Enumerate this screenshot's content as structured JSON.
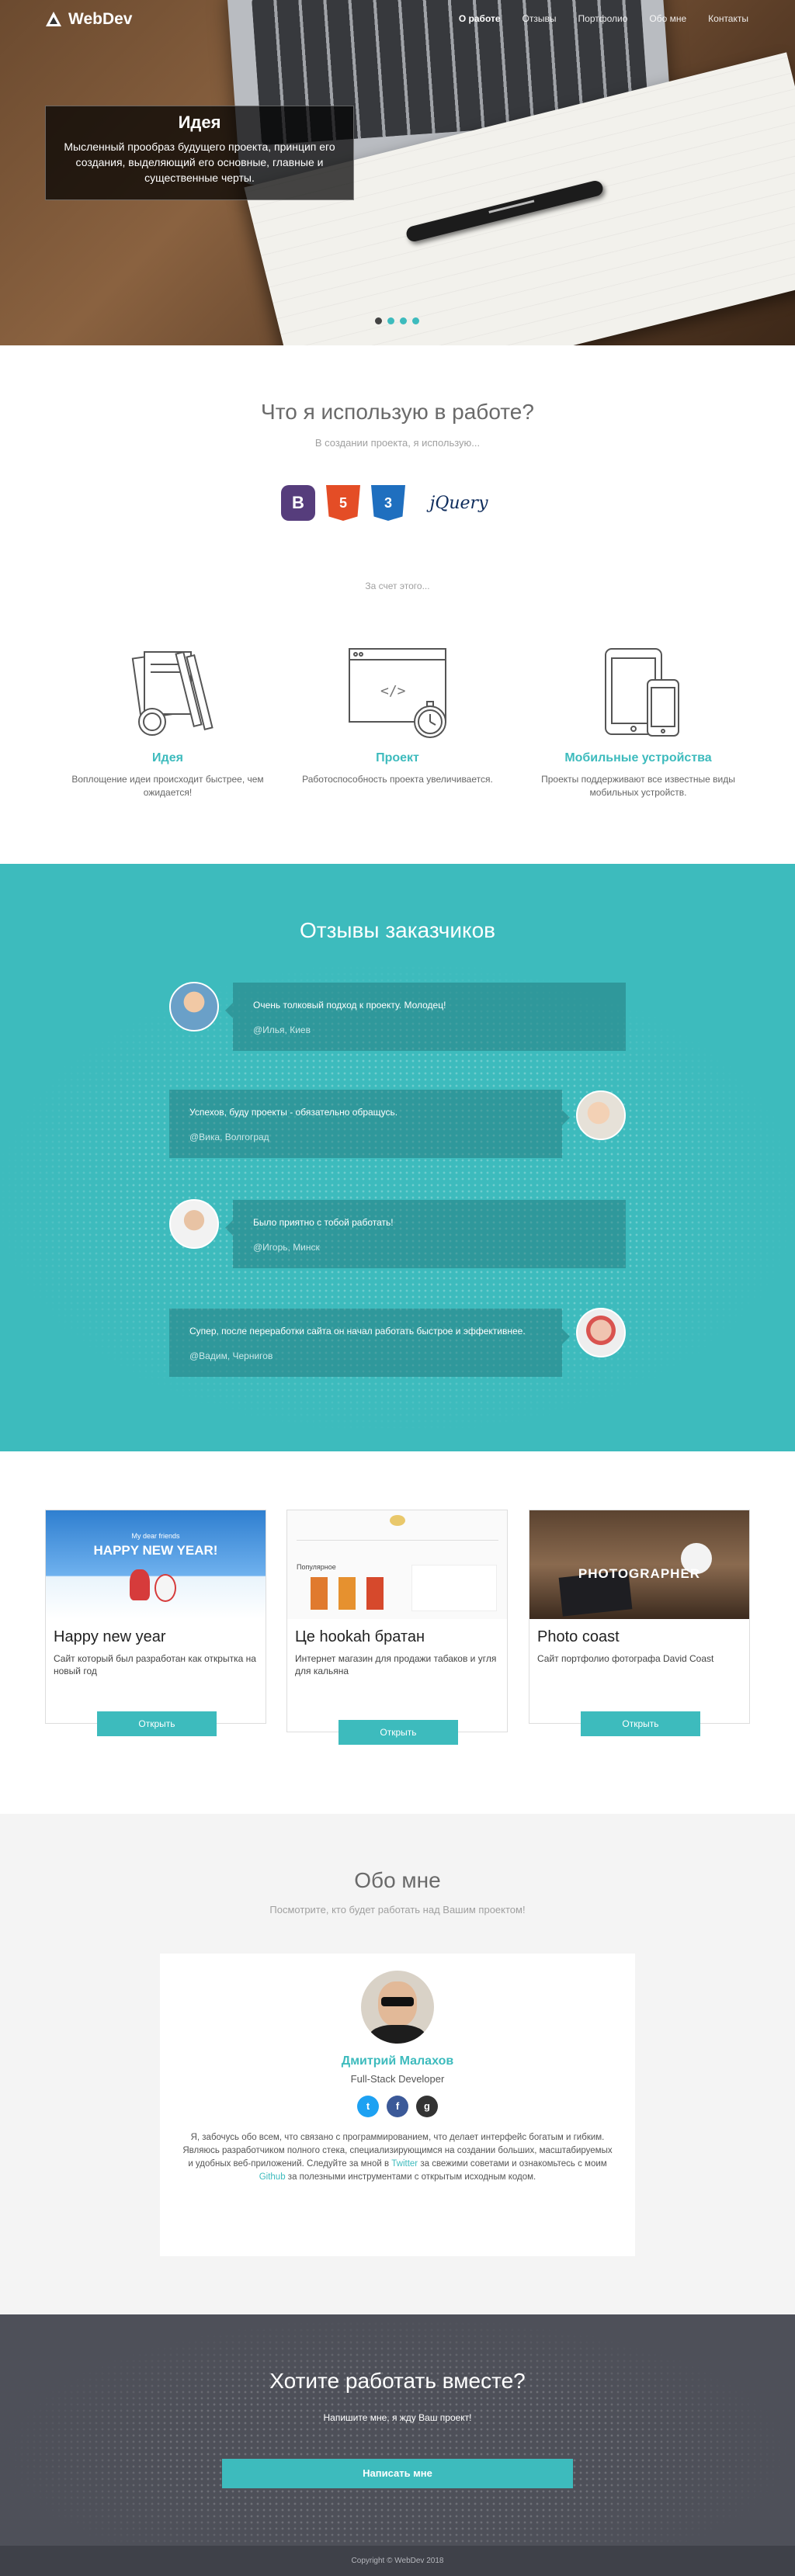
{
  "nav": {
    "logo": "WebDev",
    "items": [
      "О работе",
      "Отзывы",
      "Портфолио",
      "Обо мне",
      "Контакты"
    ]
  },
  "hero": {
    "title": "Идея",
    "text": "Мысленный прообраз будущего проекта, принцип его создания, выделяющий его основные, главные и существенные черты."
  },
  "skills": {
    "title": "Что я использую в работе?",
    "subtitle": "В создании проекта, я использую...",
    "tech": [
      "B",
      "5",
      "3",
      "jQuery"
    ],
    "because": "За счет этого...",
    "features": [
      {
        "title": "Идея",
        "text": "Воплощение идеи происходит быстрее, чем ожидается!"
      },
      {
        "title": "Проект",
        "text": "Работоспособность проекта увеличивается."
      },
      {
        "title": "Мобильные устройства",
        "text": "Проекты поддерживают все известные виды мобильных устройств."
      }
    ]
  },
  "reviews": {
    "title": "Отзывы заказчиков",
    "items": [
      {
        "text": "Очень толковый подход к проекту. Молодец!",
        "author": "@Илья, Киев"
      },
      {
        "text": "Успехов, буду проекты - обязательно обращусь.",
        "author": "@Вика, Волгоград"
      },
      {
        "text": "Было приятно с тобой работать!",
        "author": "@Игорь, Минск"
      },
      {
        "text": "Супер, после переработки сайта он начал работать быстрое и эффективнее.",
        "author": "@Вадим, Чернигов"
      }
    ]
  },
  "portfolio": {
    "items": [
      {
        "title": "Happy new year",
        "text": "Сайт который был разработан как открытка на новый год",
        "button": "Открыть",
        "thumb_caption": "HAPPY NEW YEAR!",
        "thumb_small": "My dear friends"
      },
      {
        "title": "Це hookah братан",
        "text": "Интернет магазин для продажи табаков и угля для кальяна",
        "button": "Открыть",
        "thumb_caption": "Популярное"
      },
      {
        "title": "Photo coast",
        "text": "Сайт портфолио фотографа David Coast",
        "button": "Открыть",
        "thumb_caption": "PHOTOGRAPHER"
      }
    ]
  },
  "about": {
    "title": "Обо мне",
    "subtitle": "Посмотрите, кто будет работать над Вашим проектом!",
    "name": "Дмитрий Малахов",
    "role": "Full-Stack Developer",
    "social": [
      "t",
      "f",
      "g"
    ],
    "bio_1": "Я, забочусь обо всем, что связано с программированием, что делает интерфейс богатым и гибким. Являюсь разработчиком полного стека, специализирующимся на создании больших, масштабируемых и удобных веб-приложений. Следуйте за мной в ",
    "bio_link1": "Twitter",
    "bio_2": " за свежими советами и ознакомьтесь с моим ",
    "bio_link2": "Github",
    "bio_3": " за полезными инструментами с открытым исходным кодом."
  },
  "contact": {
    "title": "Хотите работать вместе?",
    "text": "Напишите мне, я жду Ваш проект!",
    "button": "Написать мне"
  },
  "footer": {
    "text": "Copyright © WebDev 2018"
  },
  "colors": {
    "accent": "#3dbbbd",
    "dark": "#4e5059"
  }
}
